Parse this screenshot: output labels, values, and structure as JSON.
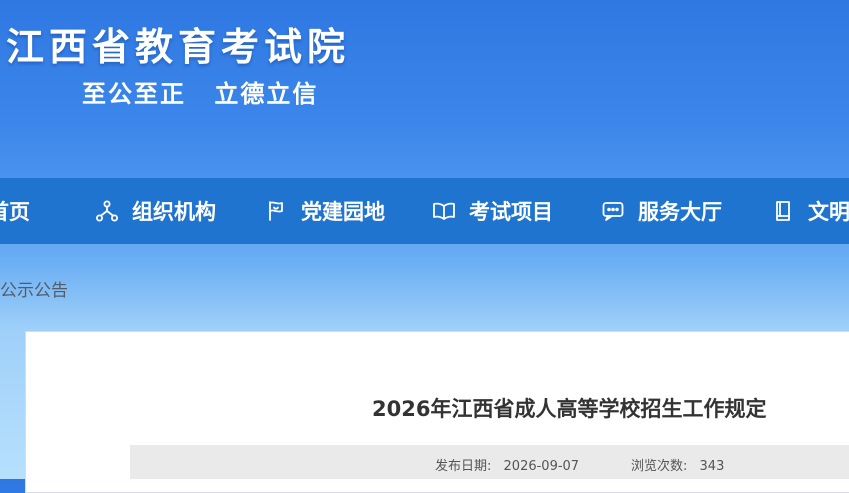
{
  "header": {
    "site_title": "江西省教育考试院",
    "slogan": "至公至正  立德立信"
  },
  "nav": {
    "items": [
      {
        "label": "首页",
        "icon": "home-icon"
      },
      {
        "label": "组织机构",
        "icon": "org-chart-icon"
      },
      {
        "label": "党建园地",
        "icon": "party-flag-icon"
      },
      {
        "label": "考试项目",
        "icon": "open-book-icon"
      },
      {
        "label": "服务大厅",
        "icon": "chat-icon"
      },
      {
        "label": "文明",
        "icon": "book-icon"
      }
    ]
  },
  "breadcrumb": {
    "text": "公示公告"
  },
  "article": {
    "title": "2026年江西省成人高等学校招生工作规定",
    "publish_date_label": "发布日期:",
    "publish_date": "2026-09-07",
    "views_label": "浏览次数:",
    "views": "343"
  },
  "colors": {
    "nav_background": "#1f74d0",
    "header_gradient_top": "#2f78e2",
    "page_gradient_bottom": "#b7e0fc",
    "title_text": "#333333"
  }
}
